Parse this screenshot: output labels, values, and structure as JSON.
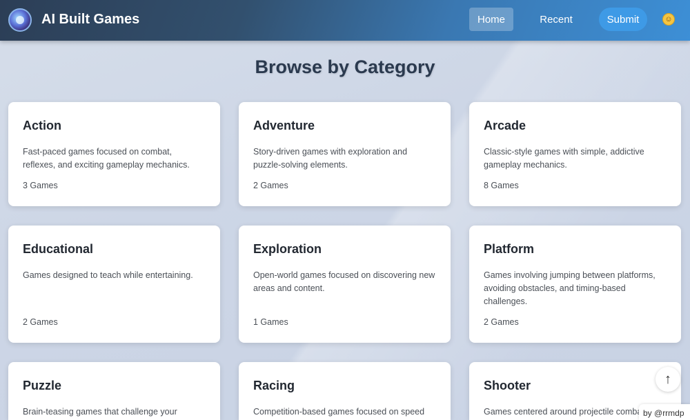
{
  "header": {
    "title": "AI Built Games",
    "logo_icon": "robot-logo-icon",
    "nav": {
      "home": "Home",
      "recent": "Recent",
      "submit": "Submit"
    },
    "theme_icon": "smiley-icon"
  },
  "main": {
    "title": "Browse by Category",
    "categories": [
      {
        "name": "Action",
        "description": "Fast-paced games focused on combat, reflexes, and exciting gameplay mechanics.",
        "count": "3 Games"
      },
      {
        "name": "Adventure",
        "description": "Story-driven games with exploration and puzzle-solving elements.",
        "count": "2 Games"
      },
      {
        "name": "Arcade",
        "description": "Classic-style games with simple, addictive gameplay mechanics.",
        "count": "8 Games"
      },
      {
        "name": "Educational",
        "description": "Games designed to teach while entertaining.",
        "count": "2 Games"
      },
      {
        "name": "Exploration",
        "description": "Open-world games focused on discovering new areas and content.",
        "count": "1 Games"
      },
      {
        "name": "Platform",
        "description": "Games involving jumping between platforms, avoiding obstacles, and timing-based challenges.",
        "count": "2 Games"
      },
      {
        "name": "Puzzle",
        "description": "Brain-teasing games that challenge your",
        "count": ""
      },
      {
        "name": "Racing",
        "description": "Competition-based games focused on speed",
        "count": ""
      },
      {
        "name": "Shooter",
        "description": "Games centered around projectile comba",
        "count": ""
      }
    ]
  },
  "scroll_top": {
    "label": "↑",
    "icon": "arrow-up-icon"
  },
  "credit": "by @rrmdp"
}
